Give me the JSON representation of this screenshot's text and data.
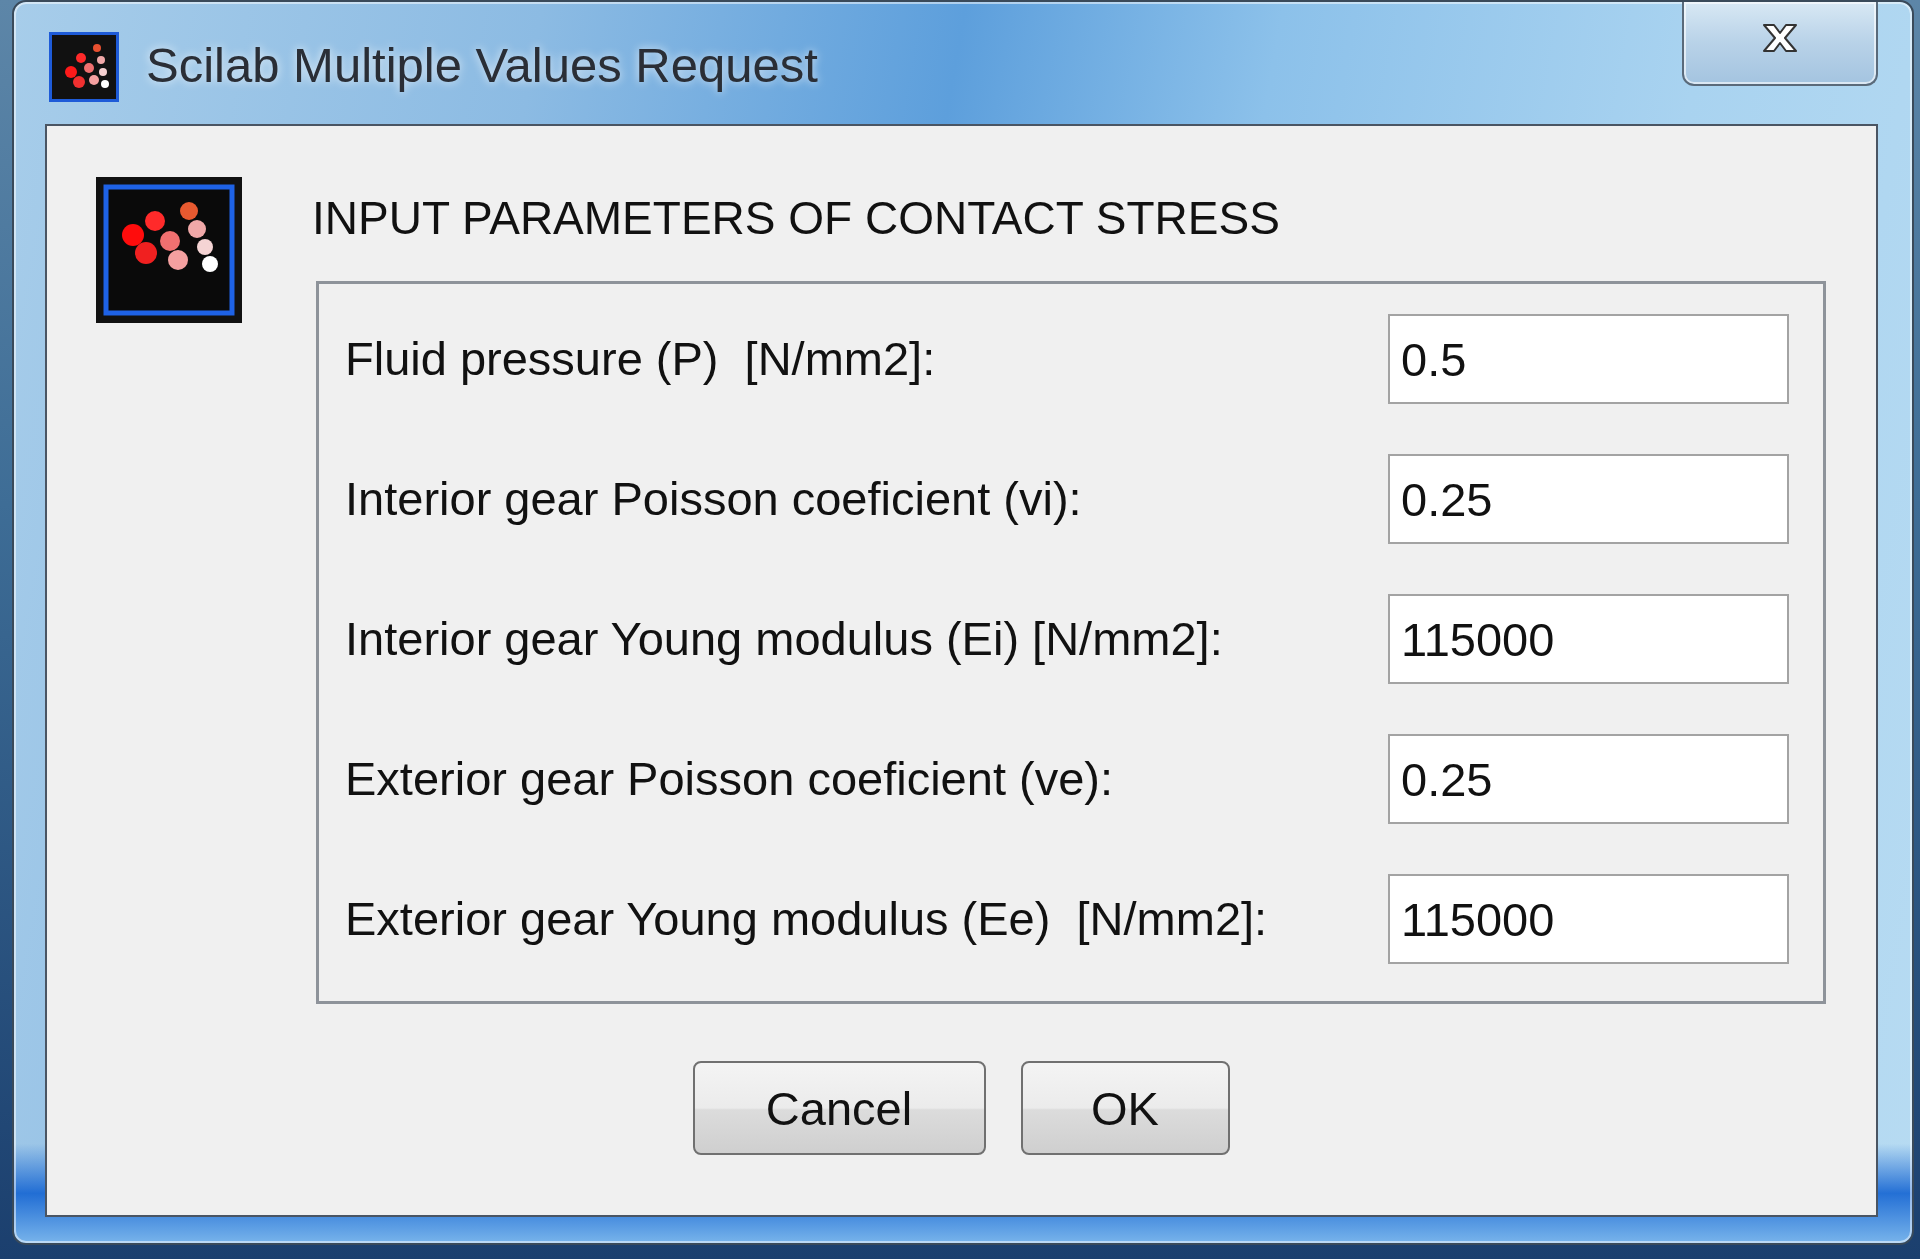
{
  "window": {
    "title": "Scilab Multiple Values Request"
  },
  "heading": "INPUT PARAMETERS OF CONTACT STRESS",
  "fields": [
    {
      "label": "Fluid pressure (P)  [N/mm2]:",
      "value": "0.5"
    },
    {
      "label": "Interior gear Poisson coeficient (vi):",
      "value": "0.25"
    },
    {
      "label": "Interior gear Young modulus (Ei) [N/mm2]:",
      "value": "115000"
    },
    {
      "label": "Exterior gear Poisson coeficient (ve):",
      "value": "0.25"
    },
    {
      "label": "Exterior gear Young modulus (Ee)  [N/mm2]:",
      "value": "115000"
    }
  ],
  "buttons": [
    "Cancel",
    "OK"
  ]
}
